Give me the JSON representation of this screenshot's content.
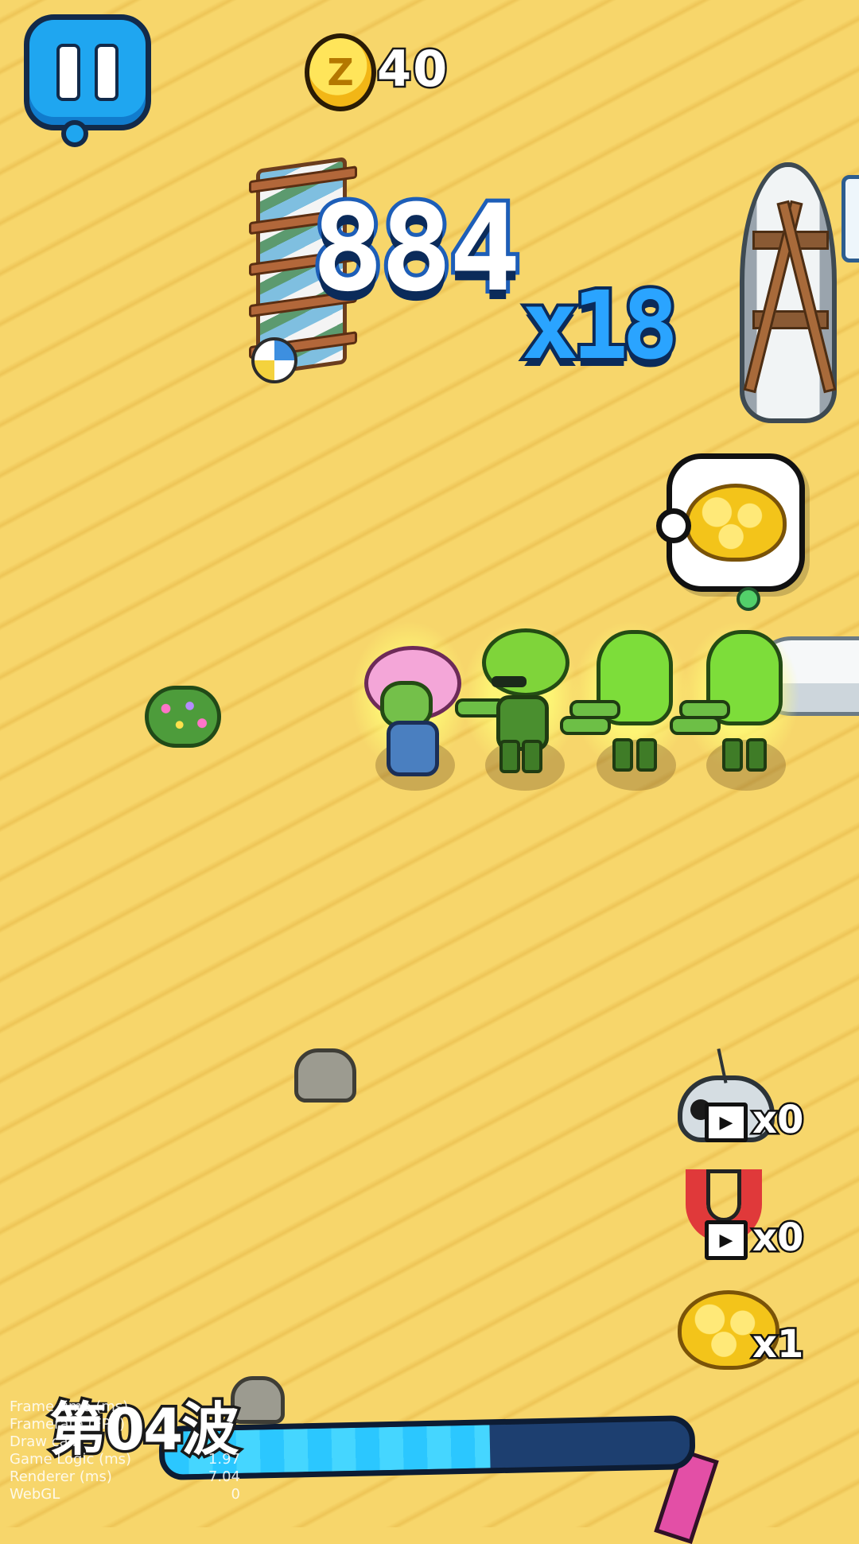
{
  "hud": {
    "pause_icon": "pause-icon",
    "coin_icon_symbol": "Z",
    "coin_count": "40",
    "score": "884",
    "combo": "x18"
  },
  "powerups": [
    {
      "name": "bomb",
      "icon": "drone-bomb-icon",
      "ad_icon": "video-ad-icon",
      "count": "x0"
    },
    {
      "name": "magnet",
      "icon": "magnet-icon",
      "ad_icon": "video-ad-icon",
      "count": "x0"
    },
    {
      "name": "brain",
      "icon": "brain-icon",
      "count": "x1"
    }
  ],
  "wave": {
    "label": "第04波",
    "progress": 0.62
  },
  "debug": {
    "rows": [
      {
        "label": "Frame time (ms)",
        "value": ""
      },
      {
        "label": "Framerate (FPS)",
        "value": ""
      },
      {
        "label": "Draw call",
        "value": ""
      },
      {
        "label": "Game Logic (ms)",
        "value": "1.97"
      },
      {
        "label": "Renderer (ms)",
        "value": "7.04"
      },
      {
        "label": "WebGL",
        "value": "0"
      }
    ]
  },
  "colors": {
    "sand": "#f7d66b",
    "accent_blue": "#1fa6f0",
    "zombie_green": "#6dbf46",
    "coin_gold": "#f2b616"
  }
}
